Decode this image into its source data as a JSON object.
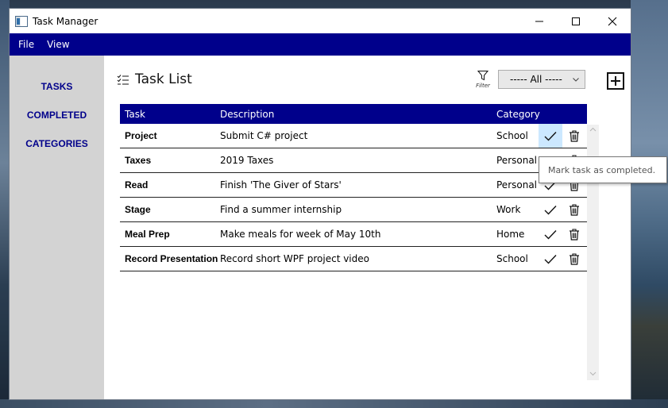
{
  "window": {
    "title": "Task Manager"
  },
  "menu": {
    "items": [
      "File",
      "View"
    ]
  },
  "sidebar": {
    "items": [
      "TASKS",
      "COMPLETED",
      "CATEGORIES"
    ]
  },
  "page": {
    "title": "Task List"
  },
  "filter": {
    "label": "Filter",
    "selected": "----- All -----"
  },
  "table": {
    "headers": {
      "task": "Task",
      "description": "Description",
      "category": "Category"
    },
    "rows": [
      {
        "task": "Project",
        "description": "Submit C# project",
        "category": "School"
      },
      {
        "task": "Taxes",
        "description": "2019 Taxes",
        "category": "Personal"
      },
      {
        "task": "Read",
        "description": "Finish 'The Giver of Stars'",
        "category": "Personal"
      },
      {
        "task": "Stage",
        "description": "Find a summer internship",
        "category": "Work"
      },
      {
        "task": "Meal Prep",
        "description": "Make meals for week of May 10th",
        "category": "Home"
      },
      {
        "task": "Record Presentation",
        "description": "Record short WPF project video",
        "category": "School"
      }
    ]
  },
  "tooltip": {
    "text": "Mark task as completed."
  },
  "colors": {
    "accent": "#00008b",
    "sidebar_bg": "#d3d3d3",
    "highlight": "#cce8ff"
  },
  "icons": [
    "app-icon",
    "minimize-icon",
    "maximize-icon",
    "close-icon",
    "task-list-icon",
    "filter-icon",
    "chevron-down-icon",
    "add-icon",
    "checkmark-icon",
    "trash-icon"
  ]
}
